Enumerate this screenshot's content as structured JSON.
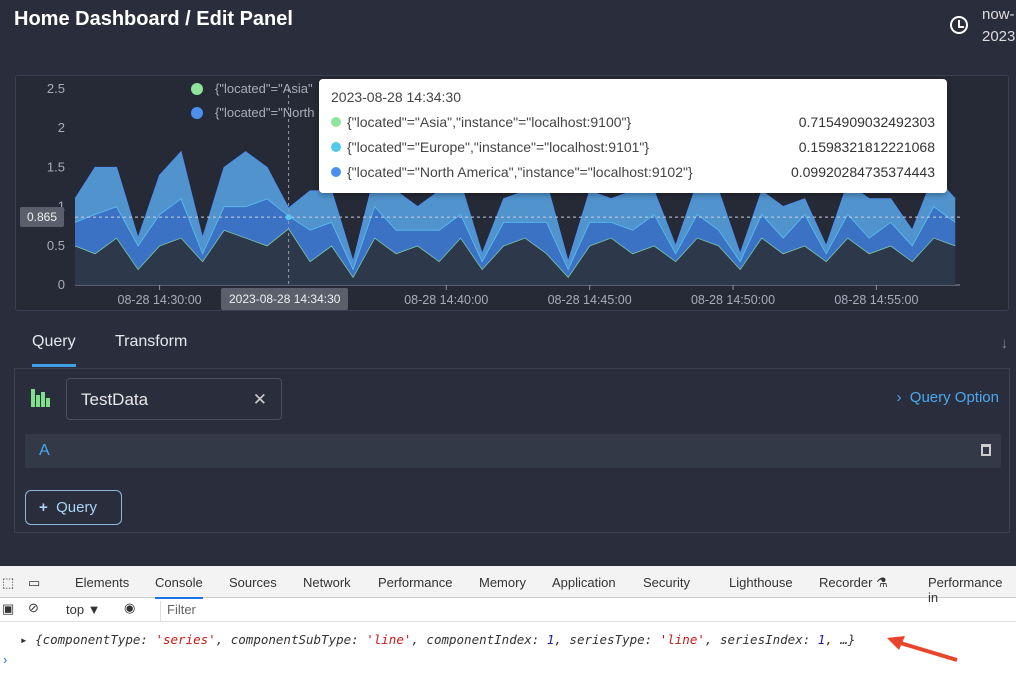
{
  "header": {
    "title": "Home Dashboard / Edit Panel",
    "time_range_line1": "now-",
    "time_range_line2": "2023"
  },
  "chart_data": {
    "type": "area",
    "stacked": true,
    "x": [
      "14:27:00",
      "14:27:45",
      "14:28:30",
      "14:29:15",
      "14:30:00",
      "14:30:45",
      "14:31:30",
      "14:32:15",
      "14:33:00",
      "14:33:45",
      "14:34:30",
      "14:35:15",
      "14:36:00",
      "14:36:45",
      "14:37:30",
      "14:38:15",
      "14:39:00",
      "14:39:45",
      "14:40:30",
      "14:41:15",
      "14:42:00",
      "14:42:45",
      "14:43:30",
      "14:44:15",
      "14:45:00",
      "14:45:45",
      "14:46:30",
      "14:47:15",
      "14:48:00",
      "14:48:45",
      "14:49:30",
      "14:50:15",
      "14:51:00",
      "14:51:45",
      "14:52:30",
      "14:53:15",
      "14:54:00",
      "14:54:45",
      "14:55:30",
      "14:56:15",
      "14:57:00",
      "14:57:45"
    ],
    "series": [
      {
        "name": "{\"located\"=\"Asia\",\"instance\"=\"localhost:9100\"}",
        "color": "#8fe39a",
        "values": [
          0.5,
          0.4,
          0.6,
          0.2,
          0.5,
          0.6,
          0.3,
          0.7,
          0.6,
          0.5,
          0.72,
          0.3,
          0.5,
          0.1,
          0.6,
          0.4,
          0.5,
          0.3,
          0.6,
          0.2,
          0.5,
          0.6,
          0.4,
          0.1,
          0.5,
          0.6,
          0.4,
          0.5,
          0.3,
          0.6,
          0.5,
          0.2,
          0.6,
          0.4,
          0.5,
          0.3,
          0.6,
          0.4,
          0.5,
          0.3,
          0.6,
          0.5
        ]
      },
      {
        "name": "{\"located\"=\"Europe\",\"instance\"=\"localhost:9101\"}",
        "color": "#56c8ef",
        "values": [
          0.3,
          0.5,
          0.4,
          0.3,
          0.4,
          0.5,
          0.1,
          0.3,
          0.4,
          0.6,
          0.16,
          0.4,
          0.3,
          0.1,
          0.4,
          0.3,
          0.2,
          0.4,
          0.3,
          0.1,
          0.3,
          0.2,
          0.4,
          0.1,
          0.3,
          0.2,
          0.3,
          0.4,
          0.1,
          0.3,
          0.2,
          0.1,
          0.3,
          0.2,
          0.4,
          0.1,
          0.3,
          0.2,
          0.3,
          0.2,
          0.4,
          0.3
        ]
      },
      {
        "name": "{\"located\"=\"North America\",\"instance\"=\"localhost:9102\"}",
        "color": "#4d8fee",
        "values": [
          0.3,
          0.6,
          0.5,
          0.1,
          0.5,
          0.6,
          0.2,
          0.5,
          0.7,
          0.4,
          0.1,
          0.5,
          0.4,
          0.1,
          0.4,
          0.5,
          0.3,
          0.5,
          0.4,
          0.1,
          0.3,
          0.4,
          0.5,
          0.1,
          0.4,
          0.3,
          0.5,
          0.3,
          0.1,
          0.4,
          0.5,
          0.1,
          0.3,
          0.4,
          0.2,
          0.1,
          0.4,
          0.5,
          0.3,
          0.2,
          0.4,
          0.3
        ]
      }
    ],
    "yticks": [
      "0",
      "0.5",
      "1",
      "1.5",
      "2",
      "2.5"
    ],
    "ylim": [
      0,
      2.5
    ],
    "xticks": [
      "08-28 14:30:00",
      "08-28 14:40:00",
      "08-28 14:45:00",
      "08-28 14:50:00",
      "08-28 14:55:00"
    ],
    "legend": [
      "{\"located\"=\"Asia\"",
      "{\"located\"=\"North"
    ],
    "crosshair": {
      "y_label": "0.865",
      "x_label": "2023-08-28 14:34:30"
    },
    "tooltip": {
      "title": "2023-08-28 14:34:30",
      "rows": [
        {
          "label": "{\"located\"=\"Asia\",\"instance\"=\"localhost:9100\"}",
          "value": "0.7154909032492303"
        },
        {
          "label": "{\"located\"=\"Europe\",\"instance\"=\"localhost:9101\"}",
          "value": "0.1598321812221068"
        },
        {
          "label": "{\"located\"=\"North America\",\"instance\"=\"localhost:9102\"}",
          "value": "0.09920284735374443"
        }
      ]
    }
  },
  "tabs": [
    "Query",
    "Transform"
  ],
  "query": {
    "datasource": "TestData",
    "query_option": "Query Option",
    "row_label": "A",
    "add_query": "Query"
  },
  "devtools": {
    "tabs": [
      "Elements",
      "Console",
      "Sources",
      "Network",
      "Performance",
      "Memory",
      "Application",
      "Security",
      "Lighthouse",
      "Recorder ⚗",
      "Performance in"
    ],
    "context": "top ▼",
    "filter_placeholder": "Filter",
    "log": {
      "p1": "{componentType: ",
      "v1": "'series'",
      "p2": ", componentSubType: ",
      "v2": "'line'",
      "p3": ", componentIndex: ",
      "v3": "1",
      "p4": ", seriesType: ",
      "v4": "'line'",
      "p5": ", seriesIndex: ",
      "v5": "1",
      "p6": ", …}"
    }
  },
  "annotation_color": "#e8452c"
}
